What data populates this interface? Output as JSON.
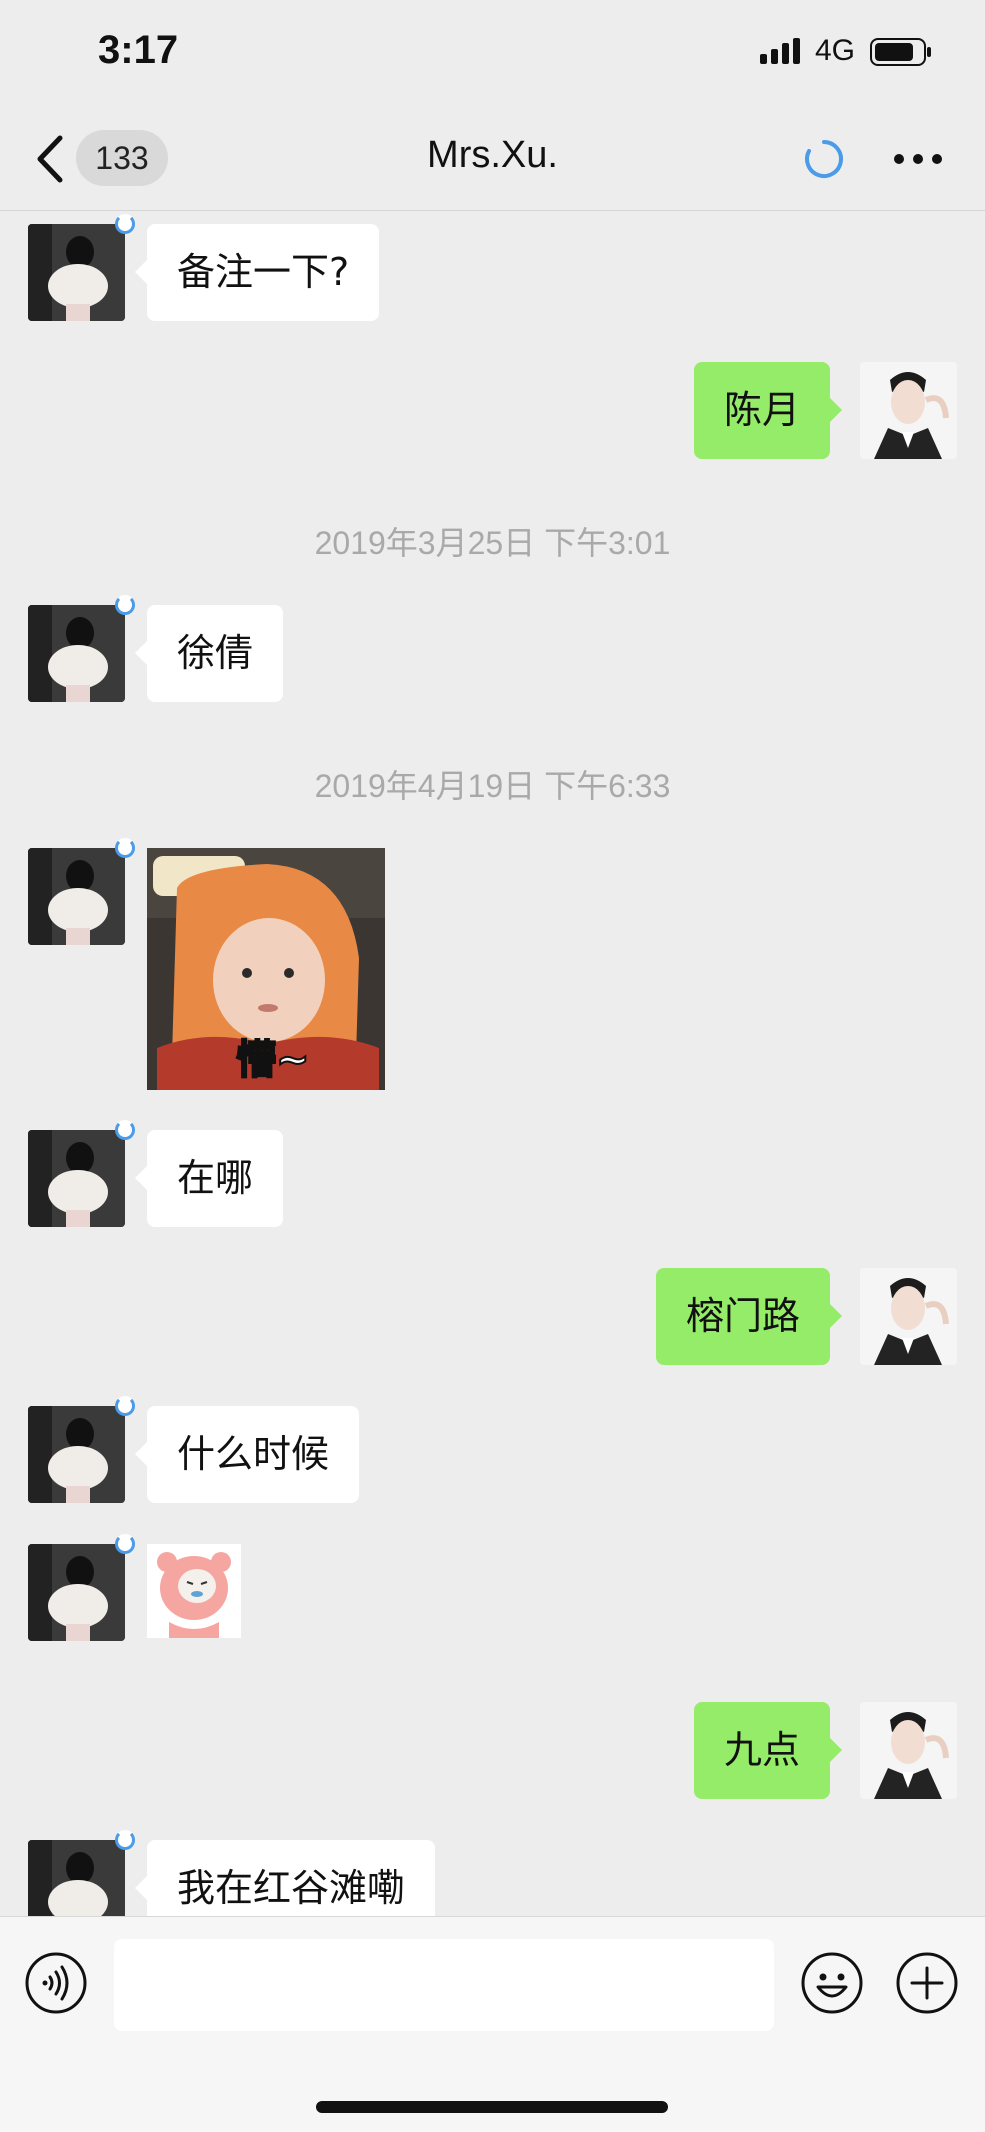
{
  "status_bar": {
    "time": "3:17",
    "network": "4G"
  },
  "nav": {
    "unread_count": "133",
    "title": "Mrs.Xu."
  },
  "messages": [
    {
      "text": "备注一下?"
    },
    {
      "text": "陈月"
    },
    {
      "timestamp": "2019年3月25日 下午3:01"
    },
    {
      "text": "徐倩"
    },
    {
      "timestamp": "2019年4月19日 下午6:33"
    },
    {
      "sticker_caption": "懵~"
    },
    {
      "text": "在哪"
    },
    {
      "text": "榕门路"
    },
    {
      "text": "什么时候"
    },
    {
      "text": "九点"
    },
    {
      "text": "我在红谷滩嘞"
    }
  ],
  "input": {
    "placeholder": ""
  },
  "colors": {
    "background": "#ededed",
    "outgoing_bubble": "#95ec69",
    "incoming_bubble": "#ffffff",
    "status_ring": "#4a9be8"
  }
}
